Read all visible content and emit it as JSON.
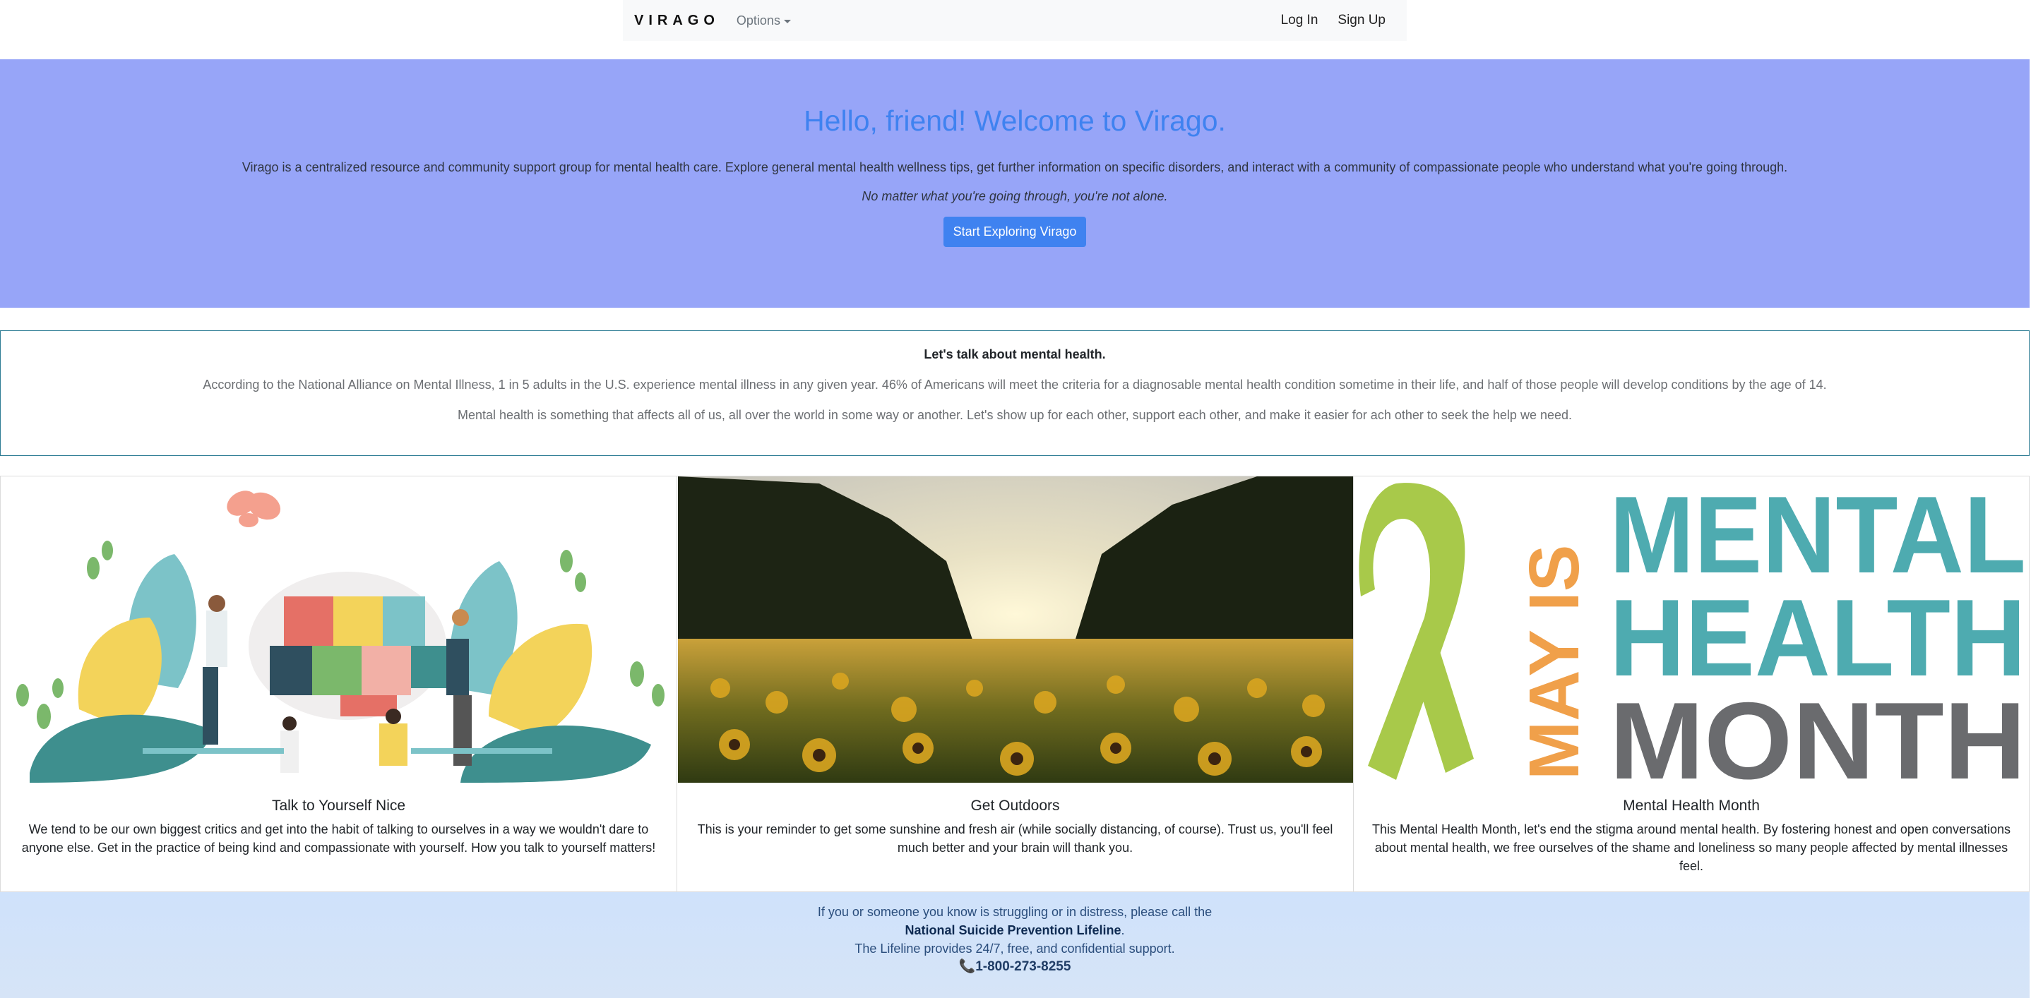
{
  "nav": {
    "brand": "VIRAGO",
    "options_label": "Options",
    "login_label": "Log In",
    "signup_label": "Sign Up"
  },
  "hero": {
    "title": "Hello, friend! Welcome to Virago.",
    "intro": "Virago is a centralized resource and community support group for mental health care. Explore general mental health wellness tips, get further information on specific disorders, and interact with a community of compassionate people who understand what you're going through.",
    "tagline": "No matter what you're going through, you're not alone.",
    "button_label": "Start Exploring Virago"
  },
  "info": {
    "title": "Let's talk about mental health.",
    "paragraph1": "According to the National Alliance on Mental Illness, 1 in 5 adults in the U.S. experience mental illness in any given year. 46% of Americans will meet the criteria for a diagnosable mental health condition sometime in their life, and half of those people will develop conditions by the age of 14.",
    "paragraph2": "Mental health is something that affects all of us, all over the world in some way or another. Let's show up for each other, support each other, and make it easier for ach other to seek the help we need."
  },
  "cards": [
    {
      "title": "Talk to Yourself Nice",
      "text": "We tend to be our own biggest critics and get into the habit of talking to ourselves in a way we wouldn't dare to anyone else. Get in the practice of being kind and compassionate with yourself. How you talk to yourself matters!"
    },
    {
      "title": "Get Outdoors",
      "text": "This is your reminder to get some sunshine and fresh air (while socially distancing, of course). Trust us, you'll feel much better and your brain will thank you."
    },
    {
      "title": "Mental Health Month",
      "text": "This Mental Health Month, let's end the stigma around mental health. By fostering honest and open conversations about mental health, we free ourselves of the shame and loneliness so many people affected by mental illnesses feel.",
      "image_text": {
        "may_is": "MAY IS",
        "mental": "MENTAL",
        "health": "HEALTH",
        "month": "MONTH"
      }
    }
  ],
  "footer": {
    "line1": "If you or someone you know is struggling or in distress, please call the",
    "lifeline_name": "National Suicide Prevention Lifeline",
    "line2_suffix": ".",
    "line3": "The Lifeline provides 24/7, free, and confidential support.",
    "phone_icon": "📞",
    "phone": "1-800-273-8255"
  },
  "colors": {
    "hero_bg": "#97a5f8",
    "accent_blue": "#3f82f0",
    "info_border": "#2d7c94",
    "footer_bg": "#cfe2fb",
    "ribbon_green": "#a8c94a",
    "teal": "#4eabb0",
    "orange": "#f0a04a",
    "gray_text": "#6a6b6e"
  }
}
